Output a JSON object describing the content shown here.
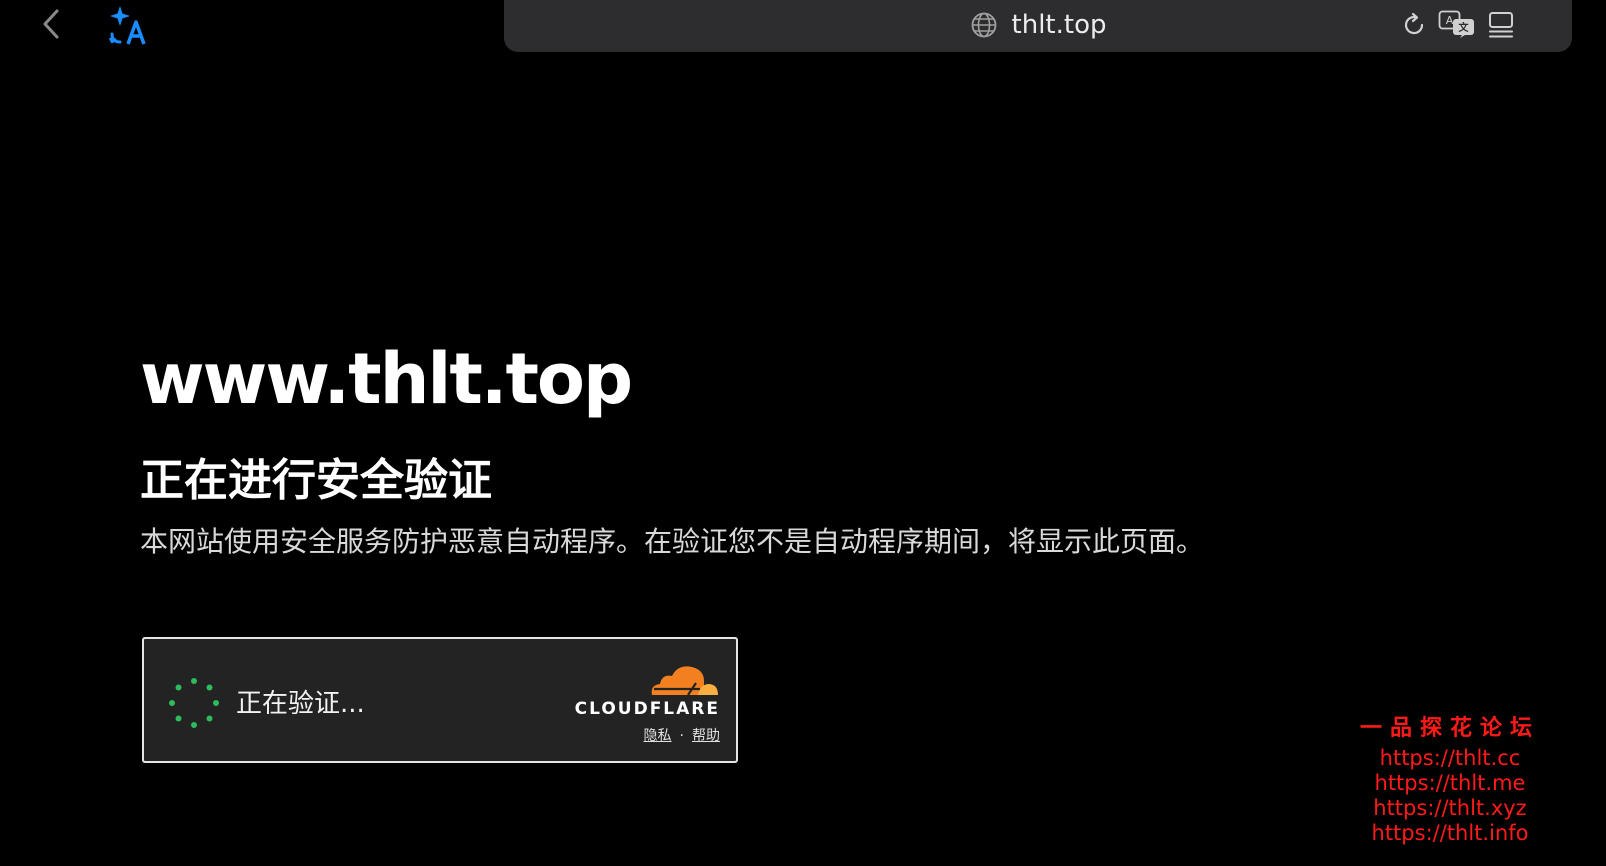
{
  "browser": {
    "url": "thlt.top",
    "icons": {
      "back": "chevron-left-icon",
      "translate_ai": "sparkle-translate-icon",
      "globe": "globe-icon",
      "reload": "reload-icon",
      "translate": "translate-icon",
      "tabs": "tab-overview-icon"
    },
    "accent_color": "#1a8cff"
  },
  "page": {
    "domain": "www.thlt.top",
    "heading": "正在进行安全验证",
    "description": "本网站使用安全服务防护恶意自动程序。在验证您不是自动程序期间，将显示此页面。"
  },
  "turnstile": {
    "status": "正在验证...",
    "brand": "CLOUDFLARE",
    "privacy_link": "隐私",
    "separator": "·",
    "help_link": "帮助",
    "spinner_color": "#2dbb5c",
    "brand_color": "#f38020"
  },
  "watermark": {
    "title": "一品探花论坛",
    "links": [
      "https://thlt.cc",
      "https://thlt.me",
      "https://thlt.xyz",
      "https://thlt.info"
    ],
    "color": "#ff1a1a"
  }
}
